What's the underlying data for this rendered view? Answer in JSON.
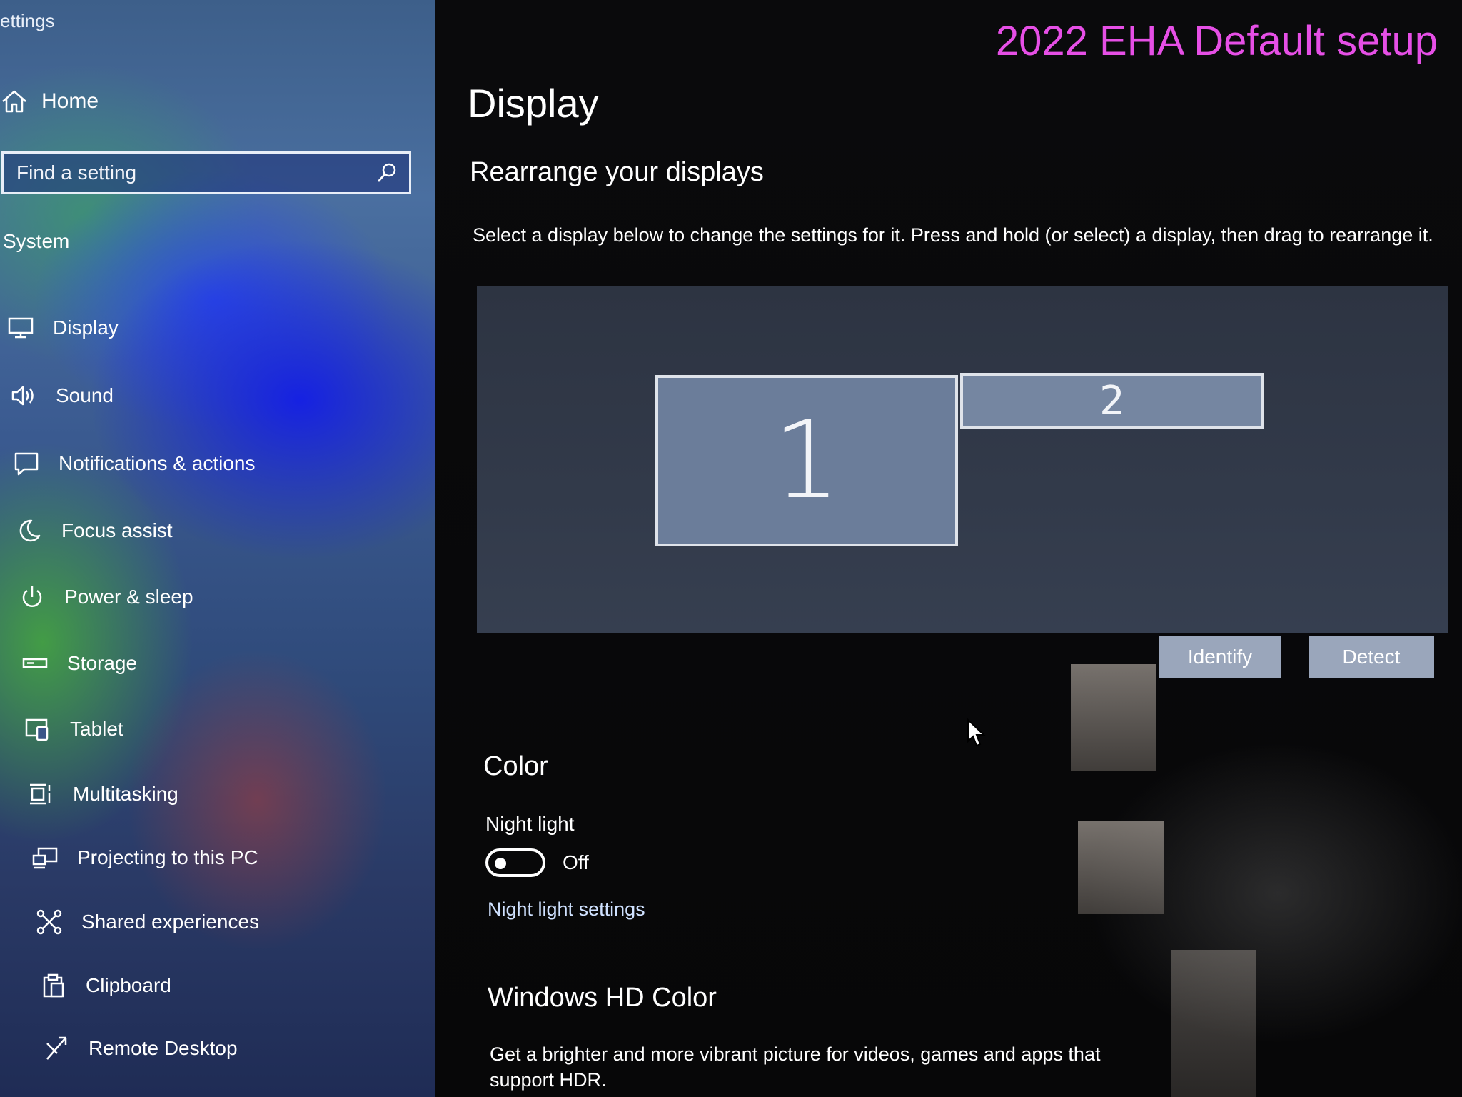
{
  "sidebar": {
    "title": "ettings",
    "home_label": "Home",
    "search": {
      "placeholder": "Find a setting"
    },
    "section_label": "System",
    "items": [
      {
        "label": "Display",
        "icon": "monitor-icon"
      },
      {
        "label": "Sound",
        "icon": "speaker-icon"
      },
      {
        "label": "Notifications & actions",
        "icon": "notification-icon"
      },
      {
        "label": "Focus assist",
        "icon": "moon-icon"
      },
      {
        "label": "Power & sleep",
        "icon": "power-icon"
      },
      {
        "label": "Storage",
        "icon": "storage-icon"
      },
      {
        "label": "Tablet",
        "icon": "tablet-icon"
      },
      {
        "label": "Multitasking",
        "icon": "multitasking-icon"
      },
      {
        "label": "Projecting to this PC",
        "icon": "projector-icon"
      },
      {
        "label": "Shared experiences",
        "icon": "shared-icon"
      },
      {
        "label": "Clipboard",
        "icon": "clipboard-icon"
      },
      {
        "label": "Remote Desktop",
        "icon": "remote-desktop-icon"
      }
    ]
  },
  "main": {
    "watermark": "2022 EHA Default setup",
    "page_title": "Display",
    "rearrange": {
      "title": "Rearrange your displays",
      "instruction": "Select a display below to change the settings for it. Press and hold (or select) a display, then drag to rearrange it.",
      "displays": [
        {
          "label": "1"
        },
        {
          "label": "2"
        }
      ],
      "identify_label": "Identify",
      "detect_label": "Detect"
    },
    "color": {
      "title": "Color",
      "night_light_label": "Night light",
      "night_light_state": "Off",
      "night_light_settings_link": "Night light settings"
    },
    "hdr": {
      "title": "Windows HD Color",
      "description": "Get a brighter and more vibrant picture for videos, games and apps that support HDR."
    }
  },
  "colors": {
    "watermark": "#e64fe6",
    "panel": "#323a4a",
    "button": "#9aa6bb",
    "link": "#cfe1ff"
  }
}
